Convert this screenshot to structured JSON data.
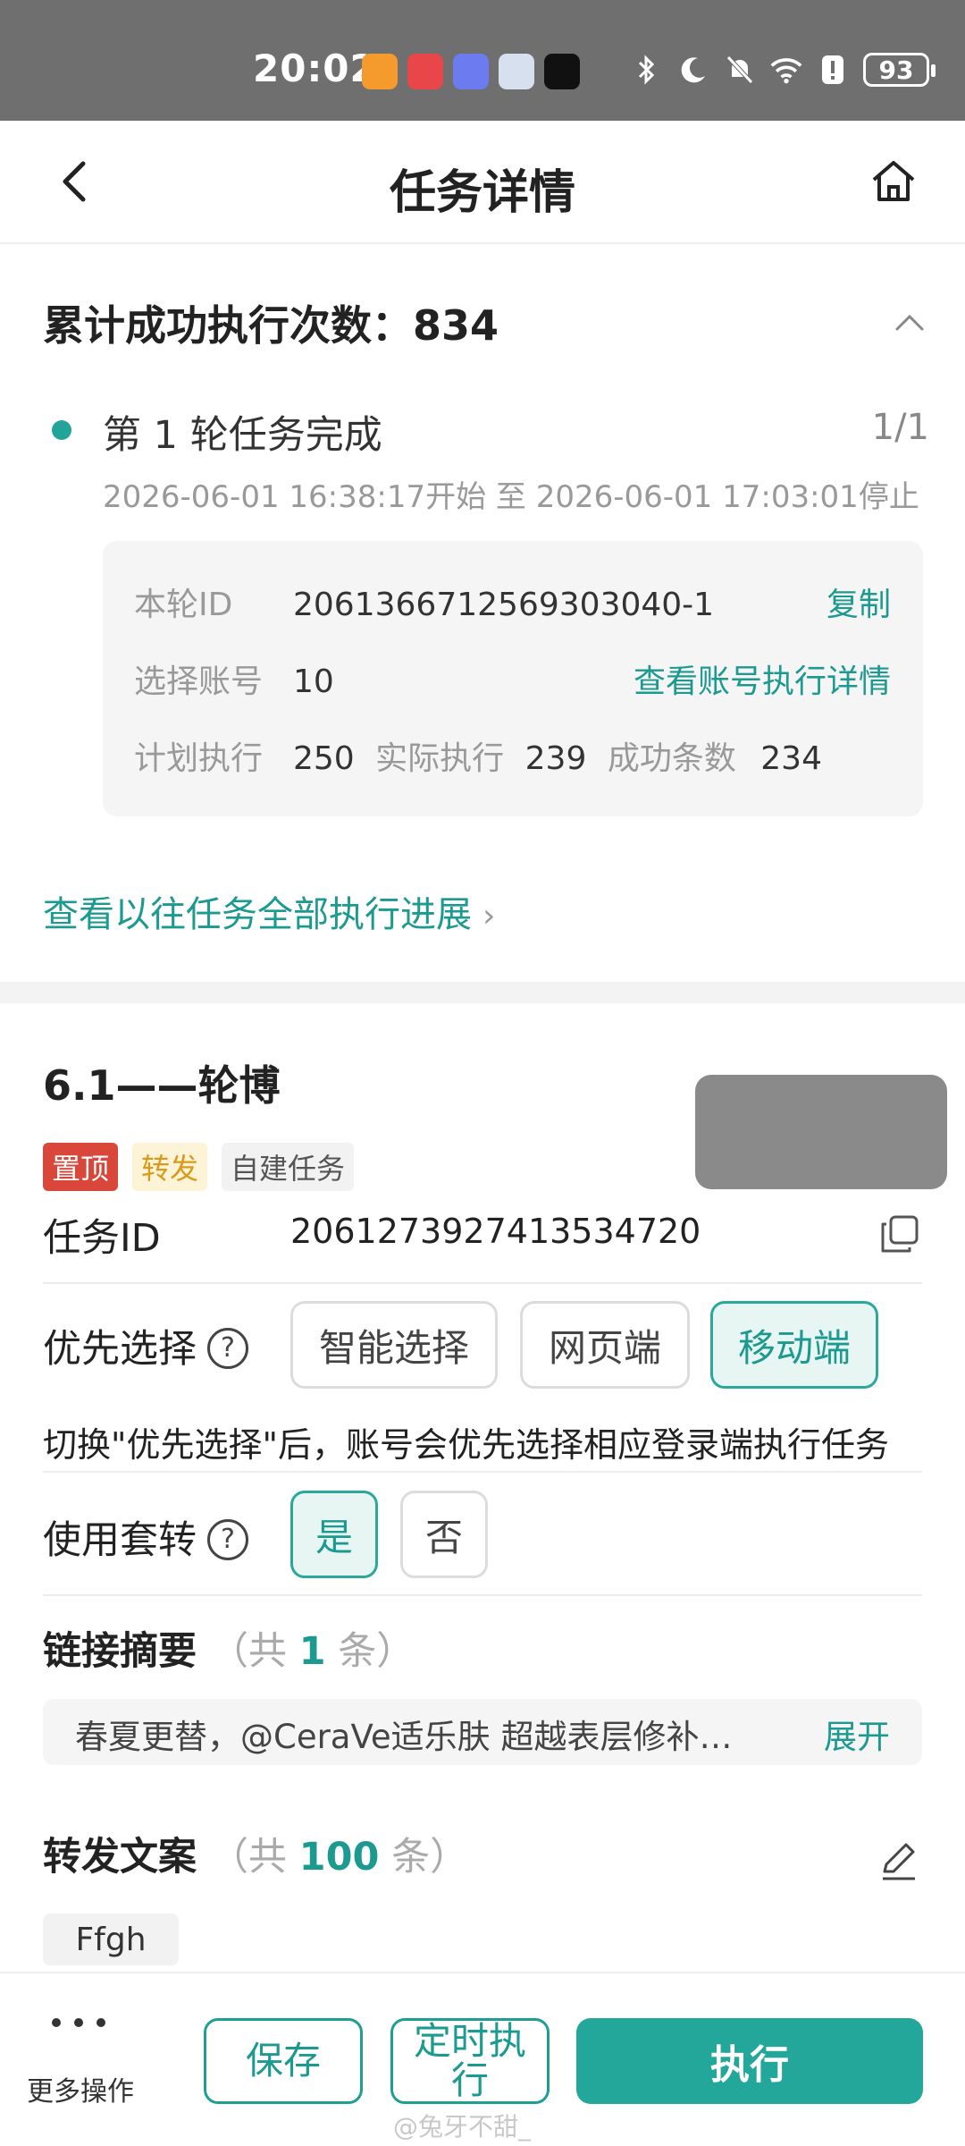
{
  "status_bar": {
    "time": "20:02",
    "battery": "93",
    "app_icons": [
      "sensor-app-icon",
      "huawei-store-icon",
      "gallery-icon",
      "snapshot-icon",
      "tiktok-icon"
    ],
    "app_colors": [
      "#f59a2c",
      "#e9464a",
      "#6c7cf0",
      "#d7e0ef",
      "#111111"
    ]
  },
  "nav": {
    "title": "任务详情"
  },
  "progress": {
    "heading": "累计成功执行次数：834",
    "round_title": "第 1 轮任务完成",
    "round_count": "1/1",
    "round_time": "2026-06-01 16:38:17开始 至 2026-06-01 17:03:01停止",
    "card": {
      "id_label": "本轮ID",
      "id_value": "2061366712569303040-1",
      "copy_label": "复制",
      "account_label": "选择账号",
      "account_value": "10",
      "account_link": "查看账号执行详情",
      "plan_label": "计划执行",
      "plan_value": "250",
      "actual_label": "实际执行",
      "actual_value": "239",
      "success_label": "成功条数",
      "success_value": "234"
    },
    "history_link": "查看以往任务全部执行进展"
  },
  "task": {
    "name": "6.1——轮博",
    "tags": [
      "置顶",
      "转发",
      "自建任务"
    ],
    "id_label": "任务ID",
    "id_value": "2061273927413534720",
    "priority_label": "优先选择",
    "priority_options": [
      "智能选择",
      "网页端",
      "移动端"
    ],
    "priority_hint": "切换\"优先选择\"后，账号会优先选择相应登录端执行任务",
    "nest_label": "使用套转",
    "nest_options": [
      "是",
      "否"
    ],
    "links_label": "链接摘要",
    "links_count_prefix": "（共",
    "links_count": "1",
    "links_count_suffix": "条）",
    "summary_text": "春夏更替，@CeraVe适乐肤 超越表层修补…",
    "summary_expand": "展开",
    "copy_label": "转发文案",
    "copy_count_prefix": "（共",
    "copy_count": "100",
    "copy_count_suffix": "条）",
    "copy_chip": "Ffgh"
  },
  "bottom": {
    "more_label": "更多操作",
    "save_label": "保存",
    "timer_label": "定时执行",
    "execute_label": "执行",
    "watermark": "@兔牙不甜_"
  },
  "colors": {
    "accent": "#23a79b",
    "tag_top": "#d8473a",
    "tag_forward": "#d99a1c"
  }
}
